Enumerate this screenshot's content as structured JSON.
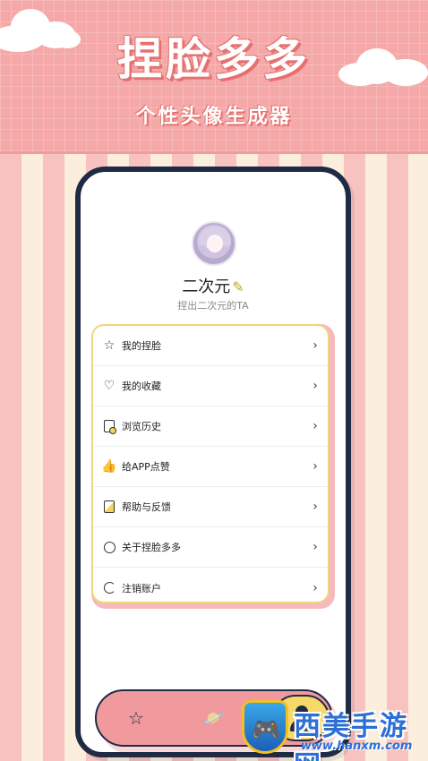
{
  "banner": {
    "title": "捏脸多多",
    "subtitle": "个性头像生成器"
  },
  "profile": {
    "avatar_icon": "anime-avatar",
    "name": "二次元",
    "name_icon": "pencil-icon",
    "tagline": "捏出二次元的TA"
  },
  "menu": {
    "items": [
      {
        "label": "我的捏脸",
        "icon": "star-outline-icon"
      },
      {
        "label": "我的收藏",
        "icon": "heart-icon"
      },
      {
        "label": "浏览历史",
        "icon": "history-doc-icon"
      },
      {
        "label": "给APP点赞",
        "icon": "thumbs-up-icon"
      },
      {
        "label": "帮助与反馈",
        "icon": "help-doc-icon"
      },
      {
        "label": "关于捏脸多多",
        "icon": "circle-icon"
      },
      {
        "label": "注销账户",
        "icon": "power-ring-icon"
      }
    ],
    "chevron": "›"
  },
  "tabbar": {
    "tabs": [
      {
        "icon": "star-tab-icon",
        "active": false
      },
      {
        "icon": "planet-tab-icon",
        "active": false
      },
      {
        "icon": "person-tab-icon",
        "active": true
      }
    ]
  },
  "watermark": {
    "text": "西美手游网",
    "url": "www.hanxm.com"
  },
  "colors": {
    "banner_pink": "#f5a8a8",
    "stripe_pink": "#f7c2c0",
    "stripe_cream": "#fbeedd",
    "phone_border": "#1f2a44",
    "menu_border": "#f1d57a",
    "tabbar_pink": "#f09a9e",
    "tab_active_yellow": "#f7d96a"
  }
}
